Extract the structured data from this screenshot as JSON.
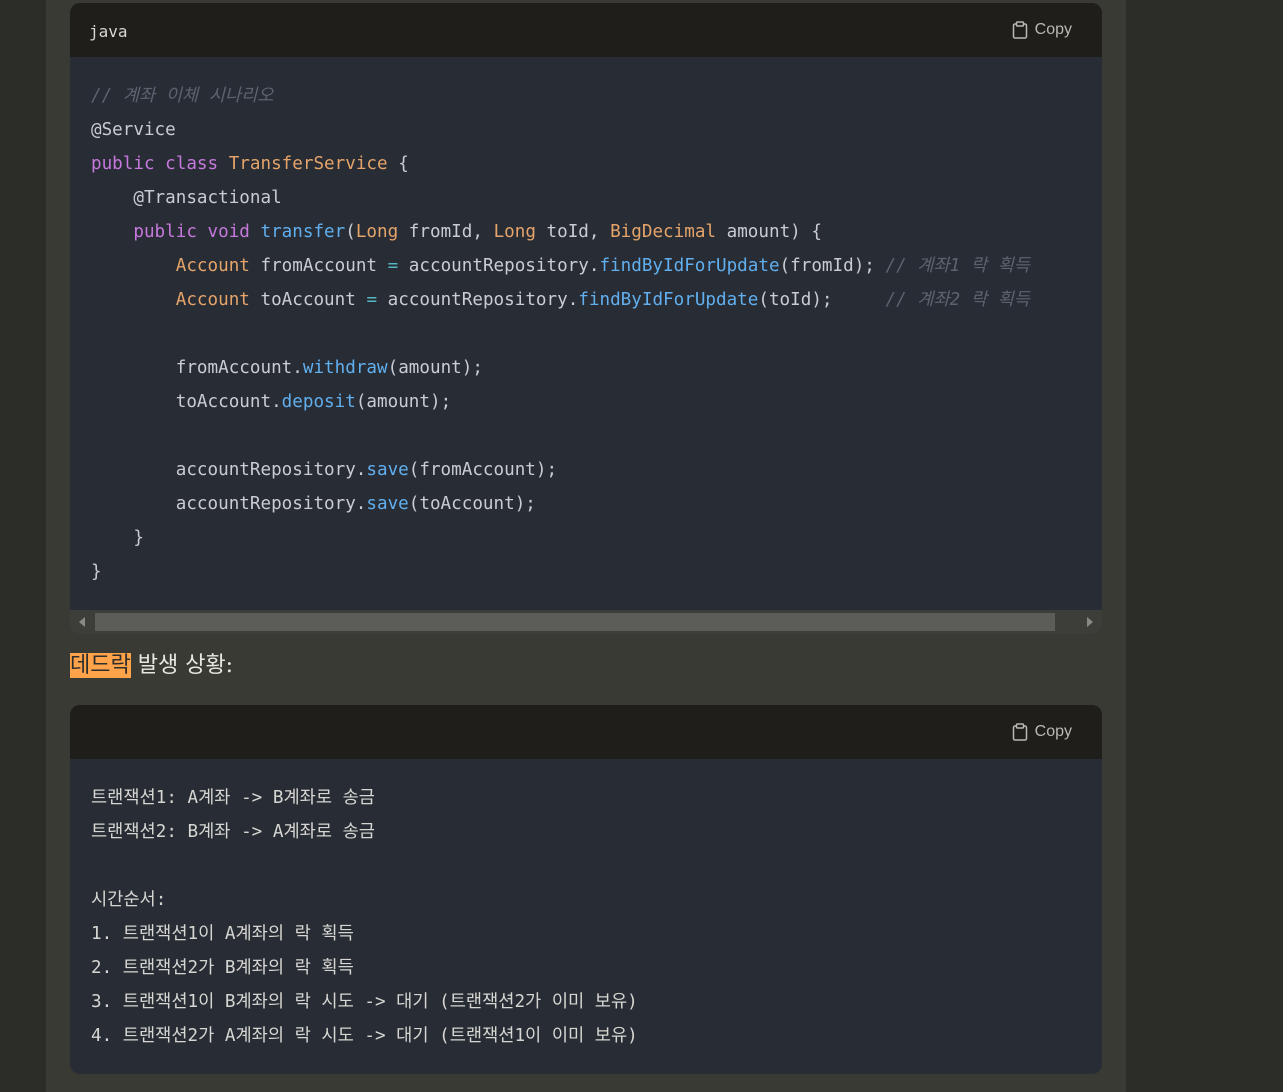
{
  "block1": {
    "language": "java",
    "copy_label": "Copy",
    "lines": [
      [
        {
          "t": "cm",
          "v": "// 계좌 이체 시나리오"
        }
      ],
      [
        {
          "t": "an",
          "v": "@Service"
        }
      ],
      [
        {
          "t": "kw",
          "v": "public"
        },
        {
          "t": "pl",
          "v": " "
        },
        {
          "t": "kw",
          "v": "class"
        },
        {
          "t": "pl",
          "v": " "
        },
        {
          "t": "ty",
          "v": "TransferService"
        },
        {
          "t": "pl",
          "v": " {"
        }
      ],
      [
        {
          "t": "pl",
          "v": "    "
        },
        {
          "t": "an",
          "v": "@Transactional"
        }
      ],
      [
        {
          "t": "pl",
          "v": "    "
        },
        {
          "t": "kw",
          "v": "public"
        },
        {
          "t": "pl",
          "v": " "
        },
        {
          "t": "kw",
          "v": "void"
        },
        {
          "t": "pl",
          "v": " "
        },
        {
          "t": "fn",
          "v": "transfer"
        },
        {
          "t": "pl",
          "v": "("
        },
        {
          "t": "ty",
          "v": "Long"
        },
        {
          "t": "pl",
          "v": " fromId, "
        },
        {
          "t": "ty",
          "v": "Long"
        },
        {
          "t": "pl",
          "v": " toId, "
        },
        {
          "t": "ty",
          "v": "BigDecimal"
        },
        {
          "t": "pl",
          "v": " amount) {"
        }
      ],
      [
        {
          "t": "pl",
          "v": "        "
        },
        {
          "t": "ty",
          "v": "Account"
        },
        {
          "t": "pl",
          "v": " fromAccount "
        },
        {
          "t": "op",
          "v": "="
        },
        {
          "t": "pl",
          "v": " accountRepository."
        },
        {
          "t": "fn",
          "v": "findByIdForUpdate"
        },
        {
          "t": "pl",
          "v": "(fromId); "
        },
        {
          "t": "cm",
          "v": "// 계좌1 락 획득"
        }
      ],
      [
        {
          "t": "pl",
          "v": "        "
        },
        {
          "t": "ty",
          "v": "Account"
        },
        {
          "t": "pl",
          "v": " toAccount "
        },
        {
          "t": "op",
          "v": "="
        },
        {
          "t": "pl",
          "v": " accountRepository."
        },
        {
          "t": "fn",
          "v": "findByIdForUpdate"
        },
        {
          "t": "pl",
          "v": "(toId);     "
        },
        {
          "t": "cm",
          "v": "// 계좌2 락 획득"
        }
      ],
      [],
      [
        {
          "t": "pl",
          "v": "        fromAccount."
        },
        {
          "t": "fn",
          "v": "withdraw"
        },
        {
          "t": "pl",
          "v": "(amount);"
        }
      ],
      [
        {
          "t": "pl",
          "v": "        toAccount."
        },
        {
          "t": "fn",
          "v": "deposit"
        },
        {
          "t": "pl",
          "v": "(amount);"
        }
      ],
      [],
      [
        {
          "t": "pl",
          "v": "        accountRepository."
        },
        {
          "t": "fn",
          "v": "save"
        },
        {
          "t": "pl",
          "v": "(fromAccount);"
        }
      ],
      [
        {
          "t": "pl",
          "v": "        accountRepository."
        },
        {
          "t": "fn",
          "v": "save"
        },
        {
          "t": "pl",
          "v": "(toAccount);"
        }
      ],
      [
        {
          "t": "pl",
          "v": "    }"
        }
      ],
      [
        {
          "t": "pl",
          "v": "}"
        }
      ]
    ]
  },
  "heading": {
    "highlighted": "데드락",
    "rest": " 발생 상황:"
  },
  "block2": {
    "copy_label": "Copy",
    "lines": [
      "트랜잭션1: A계좌 -> B계좌로 송금",
      "트랜잭션2: B계좌 -> A계좌로 송금",
      "",
      "시간순서:",
      "1. 트랜잭션1이 A계좌의 락 획득",
      "2. 트랜잭션2가 B계좌의 락 획득",
      "3. 트랜잭션1이 B계좌의 락 시도 -> 대기 (트랜잭션2가 이미 보유)",
      "4. 트랜잭션2가 A계좌의 락 시도 -> 대기 (트랜잭션1이 이미 보유)"
    ]
  },
  "icons": {
    "copy": "clipboard-icon",
    "scroll_left": "scroll-left-arrow-icon",
    "scroll_right": "scroll-right-arrow-icon"
  }
}
